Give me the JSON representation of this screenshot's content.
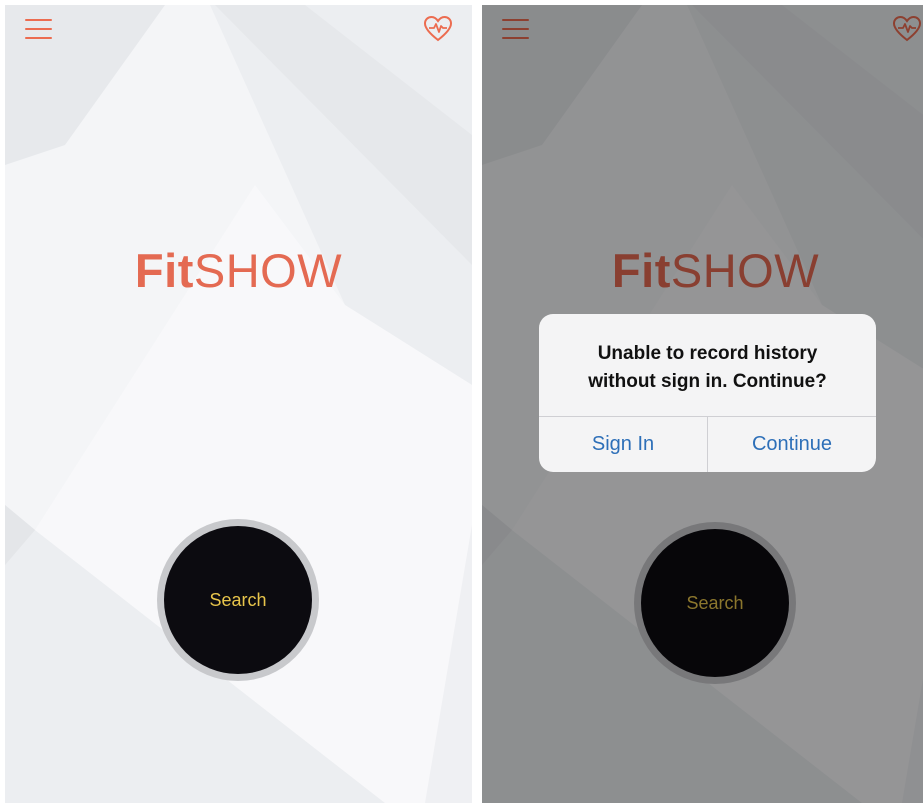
{
  "colors": {
    "brand_accent": "#e46a52",
    "search_text": "#e8c54b",
    "search_fill": "#0c0b10",
    "dialog_link": "#2d6fb8",
    "dim_overlay": "rgba(0,0,0,0.40)"
  },
  "screens": [
    {
      "header": {
        "menu_icon": "hamburger-menu-icon",
        "health_icon": "heart-pulse-icon"
      },
      "logo": {
        "part_bold": "Fit",
        "part_regular": "SHOW"
      },
      "search_button": {
        "label": "Search"
      }
    },
    {
      "header": {
        "menu_icon": "hamburger-menu-icon",
        "health_icon": "heart-pulse-icon"
      },
      "logo": {
        "part_bold": "Fit",
        "part_regular": "SHOW"
      },
      "search_button": {
        "label": "Search"
      },
      "dialog": {
        "message_line_1": "Unable to record history",
        "message_line_2": "without sign in. Continue?",
        "buttons": [
          {
            "label": "Sign In"
          },
          {
            "label": "Continue"
          }
        ]
      }
    }
  ]
}
